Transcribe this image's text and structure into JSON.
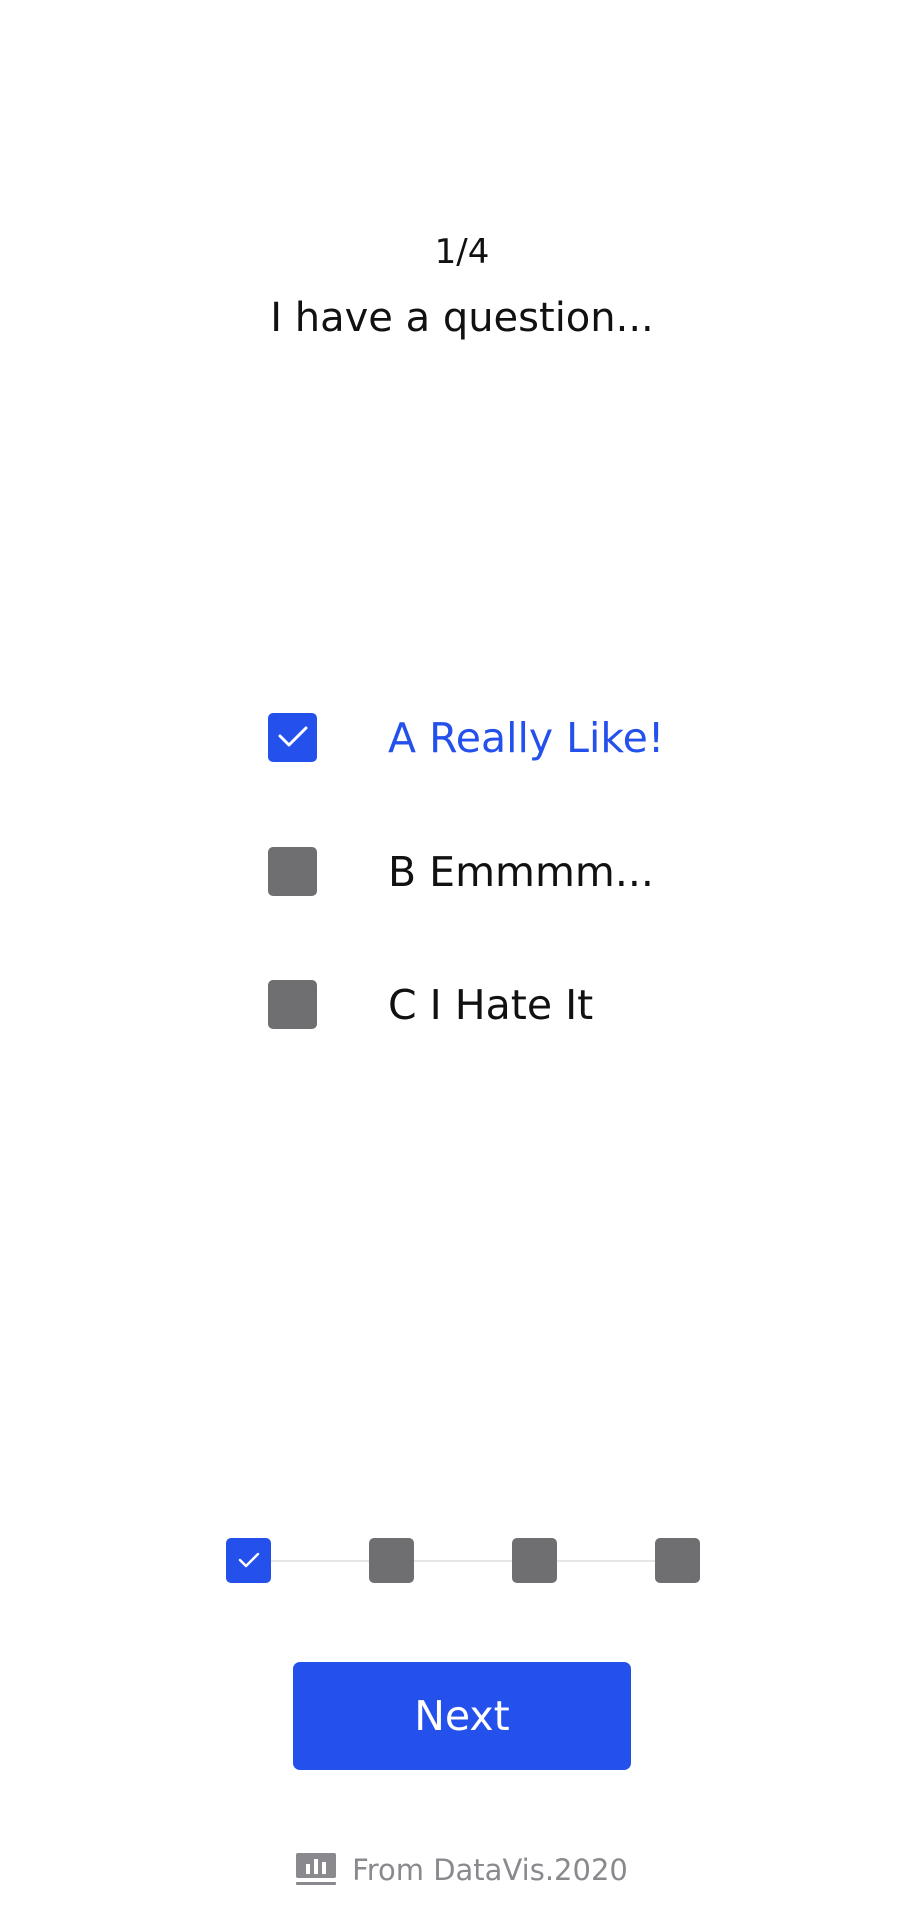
{
  "survey": {
    "progress": "1/4",
    "question": "I have a question..."
  },
  "options": [
    {
      "label": "A Really Like!",
      "checked": true
    },
    {
      "label": "B Emmmm...",
      "checked": false
    },
    {
      "label": "C I Hate It",
      "checked": false
    }
  ],
  "stepper": {
    "steps": [
      {
        "done": true
      },
      {
        "done": false
      },
      {
        "done": false
      },
      {
        "done": false
      }
    ]
  },
  "actions": {
    "next_label": "Next"
  },
  "footer": {
    "text": "From DataVis.2020",
    "icon": "bar-chart-icon"
  },
  "colors": {
    "accent": "#2450ec",
    "unchecked": "#6f6f71",
    "text": "#111111",
    "muted": "#8a8a8e",
    "divider": "#e6e6e6"
  }
}
